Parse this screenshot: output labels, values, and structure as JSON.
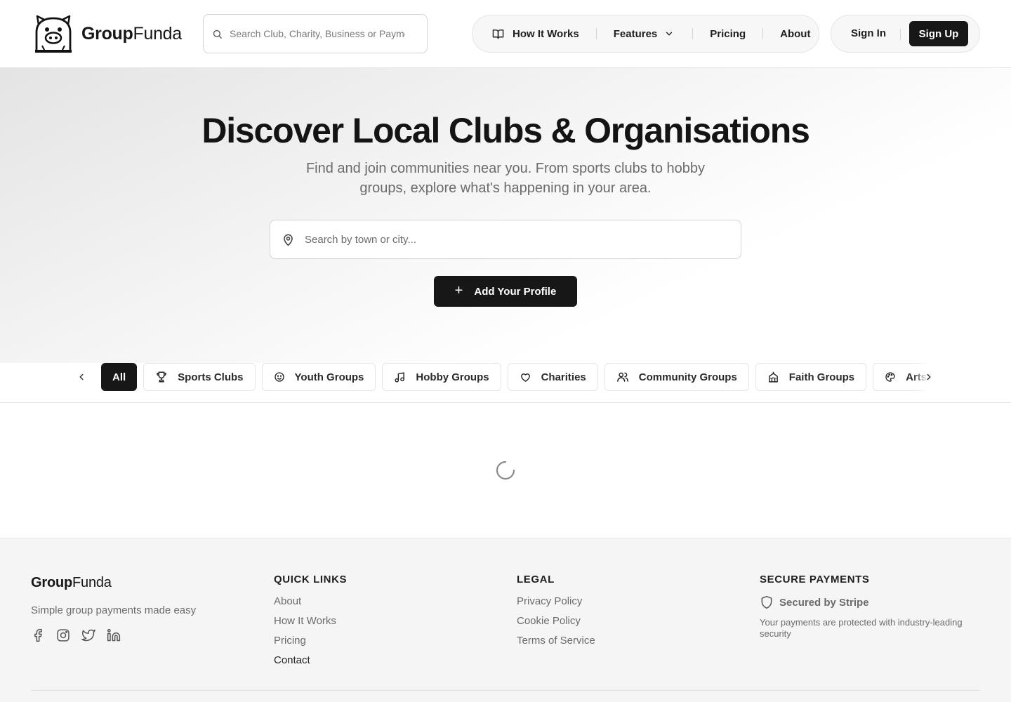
{
  "header": {
    "brand_bold": "Group",
    "brand_light": "Funda",
    "search_placeholder": "Search Club, Charity, Business or Payment",
    "nav": {
      "how_it_works": "How It Works",
      "features": "Features",
      "pricing": "Pricing",
      "about": "About"
    },
    "sign_in": "Sign In",
    "sign_up": "Sign Up"
  },
  "hero": {
    "title": "Discover Local Clubs & Organisations",
    "subtitle": "Find and join communities near you. From sports clubs to hobby groups, explore what's happening in your area.",
    "location_placeholder": "Search by town or city...",
    "add_profile": "Add Your Profile"
  },
  "categories": {
    "items": [
      {
        "label": "All",
        "icon": "none",
        "active": true
      },
      {
        "label": "Sports Clubs",
        "icon": "trophy-icon"
      },
      {
        "label": "Youth Groups",
        "icon": "smile-icon"
      },
      {
        "label": "Hobby Groups",
        "icon": "music-note-icon"
      },
      {
        "label": "Charities",
        "icon": "heart-icon"
      },
      {
        "label": "Community Groups",
        "icon": "users-icon"
      },
      {
        "label": "Faith Groups",
        "icon": "church-icon"
      },
      {
        "label": "Arts & Culture",
        "icon": "palette-icon"
      }
    ]
  },
  "content": {
    "state": "loading"
  },
  "footer": {
    "brand_bold": "Group",
    "brand_light": "Funda",
    "tagline": "Simple group payments made easy",
    "social_icons": [
      "facebook-icon",
      "instagram-icon",
      "twitter-icon",
      "linkedin-icon"
    ],
    "quick_links": {
      "heading": "QUICK LINKS",
      "links": [
        "About",
        "How It Works",
        "Pricing",
        "Contact"
      ]
    },
    "legal": {
      "heading": "LEGAL",
      "links": [
        "Privacy Policy",
        "Cookie Policy",
        "Terms of Service"
      ]
    },
    "payments": {
      "heading": "SECURE PAYMENTS",
      "badge": "Secured by Stripe",
      "note": "Your payments are protected with industry-leading security"
    }
  },
  "colors": {
    "primary": "#171717",
    "muted_text": "#6b6b6b",
    "border": "#e5e5e5",
    "footer_bg": "#f5f5f5"
  }
}
